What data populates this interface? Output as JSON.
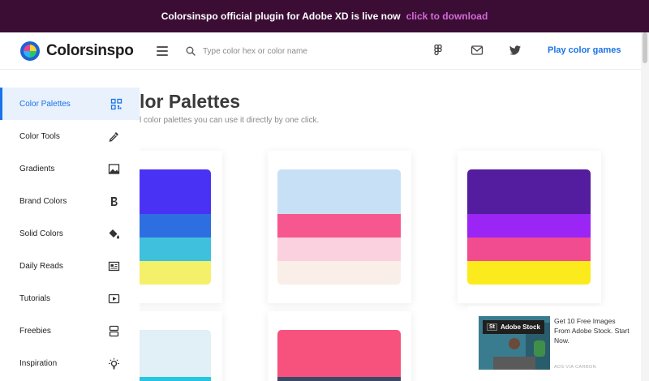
{
  "banner": {
    "text": "Colorsinspo official plugin for Adobe XD is live now",
    "cta": "click to download"
  },
  "header": {
    "brand": "Colorsinspo",
    "search_placeholder": "Type color hex or color name",
    "icons": [
      "menu-icon",
      "search-icon",
      "figma-icon",
      "mail-icon",
      "twitter-icon"
    ],
    "play_link": "Play color games",
    "accent": "#1a73e8"
  },
  "main": {
    "title": "olor Palettes",
    "subtitle": "l color palettes you can use it directly by one click."
  },
  "sidebar": {
    "items": [
      {
        "label": "Color Palettes",
        "icon": "palette-grid-icon",
        "active": true
      },
      {
        "label": "Color Tools",
        "icon": "eyedropper-icon",
        "active": false
      },
      {
        "label": "Gradients",
        "icon": "image-icon",
        "active": false
      },
      {
        "label": "Brand Colors",
        "icon": "bold-b-icon",
        "active": false
      },
      {
        "label": "Solid Colors",
        "icon": "paint-bucket-icon",
        "active": false
      },
      {
        "label": "Daily Reads",
        "icon": "newspaper-icon",
        "active": false
      },
      {
        "label": "Tutorials",
        "icon": "play-icon",
        "active": false
      },
      {
        "label": "Freebies",
        "icon": "stack-icon",
        "active": false
      },
      {
        "label": "Inspiration",
        "icon": "lightbulb-icon",
        "active": false
      }
    ]
  },
  "palettes": [
    {
      "colors": [
        "#4a32f5",
        "#2d6fe0",
        "#3fc1dd",
        "#f4f06a"
      ]
    },
    {
      "colors": [
        "#c7e0f5",
        "#f7578f",
        "#fcd1df",
        "#faeee9"
      ]
    },
    {
      "colors": [
        "#541c9e",
        "#9b25f4",
        "#f14c8f",
        "#fbeb1c"
      ]
    },
    {
      "colors": [
        "#e1eff6",
        "#25c6e0"
      ]
    },
    {
      "colors": [
        "#f7527d",
        "#3a4a66"
      ]
    }
  ],
  "ad": {
    "badge": "Adobe Stock",
    "badge_short": "St",
    "text": "Get 10 Free Images From Adobe Stock. Start Now.",
    "via": "ADS VIA CARBON"
  }
}
